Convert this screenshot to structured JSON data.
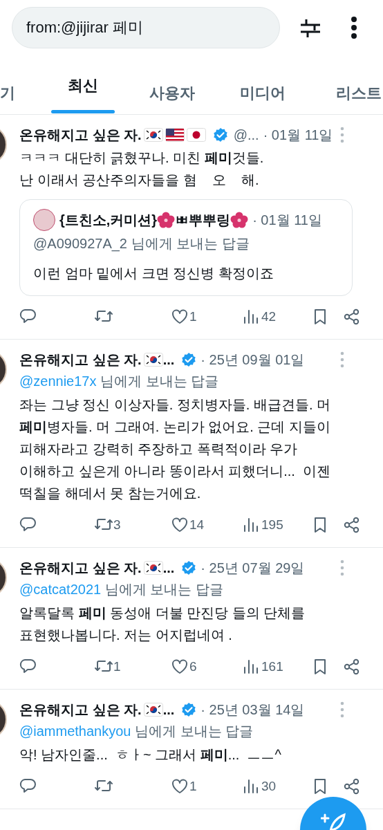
{
  "search": {
    "value": "from:@jijirar 페미"
  },
  "tabs": [
    {
      "label": "기",
      "selected": false
    },
    {
      "label": "최신",
      "selected": true
    },
    {
      "label": "사용자",
      "selected": false
    },
    {
      "label": "미디어",
      "selected": false
    },
    {
      "label": "리스트",
      "selected": false
    }
  ],
  "tweets": [
    {
      "name": "온유해지고 싶은 자.",
      "name_icons": [
        {
          "kind": "korea-flag"
        },
        {
          "kind": "usa-flag"
        },
        {
          "kind": "japan-flag"
        }
      ],
      "verified": true,
      "handle": "@...",
      "date": "· 01월 11일",
      "text": "ㅋㅋㅋ 대단히 긁혔꾸나. 미친 **페미**것들.\n난 이래서 공산주의자들을 혐    오    해.",
      "quote": {
        "name_parts": [
          {
            "kind": "text",
            "text": "{트친소,커미션}"
          },
          {
            "kind": "flower"
          },
          {
            "kind": "text",
            "text": "ㅃ뿌뿌링"
          },
          {
            "kind": "flower"
          }
        ],
        "date": "· 01월 11일",
        "reply_to": "@A090927A_2 님에게 보내는 답글",
        "text": "이런 엄마 밑에서 크면 정신병 확정이죠"
      },
      "likes": "1",
      "views": "42"
    },
    {
      "name": "온유해지고 싶은 자.",
      "name_icons": [
        {
          "kind": "korea-flag"
        }
      ],
      "name_tail": "...",
      "verified": true,
      "date": "· 25년 09월 01일",
      "reply_handle": "@zennie17x",
      "reply_suffix": "님에게 보내는 답글",
      "text": "좌는 그냥 정신 이상자들. 정치병자들. 배급견들. 머\n**페미**병자들. 머 그래여. 논리가 없어요. 근데 지들이\n피해자라고 강력히 주장하고 폭력적이라 우가\n이해하고 싶은게 아니라 똥이라서 피했더니...  이젠\n떡칠을 해데서 못 참는거에요.",
      "retweets": "3",
      "likes": "14",
      "views": "195"
    },
    {
      "name": "온유해지고 싶은 자.",
      "name_icons": [
        {
          "kind": "korea-flag"
        }
      ],
      "name_tail": "...",
      "verified": true,
      "date": "· 25년 07월 29일",
      "reply_handle": "@catcat2021",
      "reply_suffix": "님에게 보내는 답글",
      "text": "알록달록 **페미** 동성애 더불 만진당 들의 단체를\n표현했나봅니다. 저는 어지럽네여 .",
      "retweets": "1",
      "likes": "6",
      "views": "161"
    },
    {
      "name": "온유해지고 싶은 자.",
      "name_icons": [
        {
          "kind": "korea-flag"
        }
      ],
      "name_tail": "...",
      "verified": true,
      "date": "· 25년 03월 14일",
      "reply_handle": "@iammethankyou",
      "reply_suffix": "님에게 보내는 답글",
      "text": "악! 남자인줄...  ㅎㅏ~ 그래서 **페미**...  ㅡㅡ^",
      "likes": "1",
      "views": "30"
    }
  ]
}
